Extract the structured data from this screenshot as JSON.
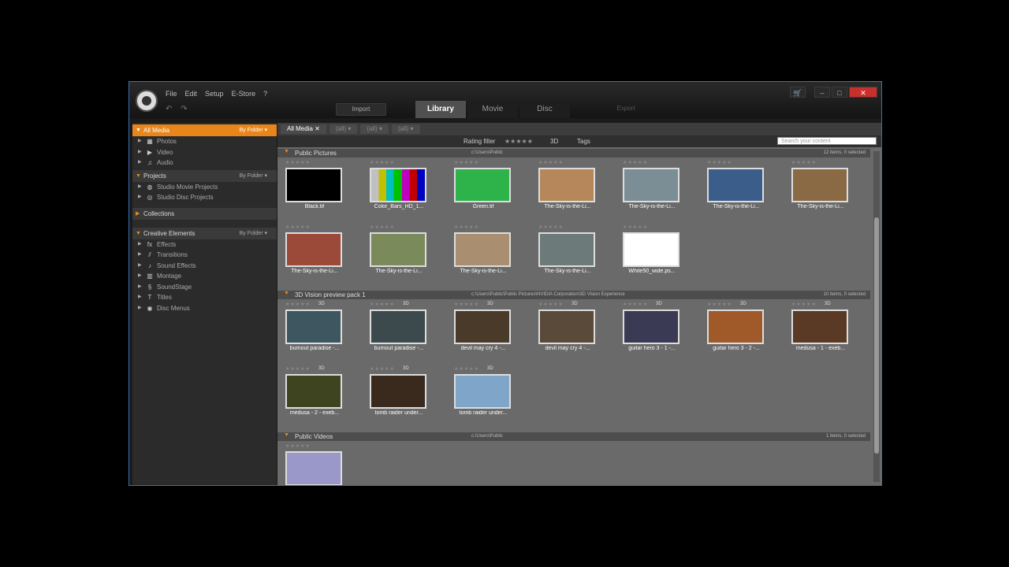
{
  "menu": [
    "File",
    "Edit",
    "Setup",
    "E-Store",
    "?"
  ],
  "toolbar": {
    "import_label": "Import",
    "export_label": "Export",
    "undo_redo": "↶ ↷"
  },
  "tabs": [
    "Library",
    "Movie",
    "Disc"
  ],
  "window_controls": {
    "cart": "🛒",
    "minimize": "–",
    "maximize": "□",
    "close": "✕"
  },
  "sidebar": {
    "all_media": {
      "label": "All Media",
      "sort": "By Folder ▾"
    },
    "media_items": [
      {
        "icon": "▦",
        "label": "Photos"
      },
      {
        "icon": "▶",
        "label": "Video"
      },
      {
        "icon": "♫",
        "label": "Audio"
      }
    ],
    "projects": {
      "label": "Projects",
      "sort": "By Folder ▾"
    },
    "project_items": [
      {
        "icon": "◍",
        "label": "Studio Movie Projects"
      },
      {
        "icon": "◎",
        "label": "Studio Disc Projects"
      }
    ],
    "collections": {
      "label": "Collections"
    },
    "creative": {
      "label": "Creative Elements",
      "sort": "By Folder ▾"
    },
    "creative_items": [
      {
        "icon": "fx",
        "label": "Effects"
      },
      {
        "icon": "⫽",
        "label": "Transitions"
      },
      {
        "icon": "♪",
        "label": "Sound Effects"
      },
      {
        "icon": "▥",
        "label": "Montage"
      },
      {
        "icon": "§",
        "label": "SoundStage"
      },
      {
        "icon": "T",
        "label": "Titles"
      },
      {
        "icon": "◉",
        "label": "Disc Menus"
      }
    ]
  },
  "filterbar": {
    "all_media": "All Media ✕",
    "filter1": "(all) ▾",
    "filter2": "(all) ▾",
    "filter3": "(all) ▾"
  },
  "ratingbar": {
    "rating_label": "Rating filter",
    "stars": "★★★★★",
    "d3": "3D",
    "tags": "Tags"
  },
  "search": {
    "placeholder": "Search your content"
  },
  "folders": [
    {
      "title": "Public Pictures",
      "path": "c:\\Users\\Public",
      "count": "12 items, 0 selected",
      "items": [
        {
          "label": "Black.tif",
          "color": "#000000",
          "d3": ""
        },
        {
          "label": "Color_Bars_HD_1...",
          "color": "#bdbdbd",
          "d3": ""
        },
        {
          "label": "Green.tif",
          "color": "#2db34a",
          "d3": ""
        },
        {
          "label": "The-Sky-is-the-Li...",
          "color": "#b5875a",
          "d3": ""
        },
        {
          "label": "The-Sky-is-the-Li...",
          "color": "#7c8e95",
          "d3": ""
        },
        {
          "label": "The-Sky-is-the-Li...",
          "color": "#3b5d8a",
          "d3": ""
        },
        {
          "label": "The-Sky-is-the-Li...",
          "color": "#8a6a45",
          "d3": ""
        },
        {
          "label": "The-Sky-is-the-Li...",
          "color": "#9b4a3a",
          "d3": ""
        },
        {
          "label": "The-Sky-is-the-Li...",
          "color": "#7a8a5a",
          "d3": ""
        },
        {
          "label": "The-Sky-is-the-Li...",
          "color": "#a98f70",
          "d3": ""
        },
        {
          "label": "The-Sky-is-the-Li...",
          "color": "#6c7a7a",
          "d3": ""
        },
        {
          "label": "White50_wide.ps...",
          "color": "#ffffff",
          "d3": ""
        }
      ]
    },
    {
      "title": "3D Vision preview pack 1",
      "path": "c:\\Users\\Public\\Public Pictures\\NVIDIA Corporation\\3D Vision Experience",
      "count": "10 items, 0 selected",
      "items": [
        {
          "label": "burnout paradise -...",
          "color": "#3e5660",
          "d3": "3D"
        },
        {
          "label": "burnout paradise -...",
          "color": "#3d4a4d",
          "d3": "3D"
        },
        {
          "label": "devil may cry 4 -...",
          "color": "#4a3a2a",
          "d3": "3D"
        },
        {
          "label": "devil may cry 4 -...",
          "color": "#5a4a3a",
          "d3": "3D"
        },
        {
          "label": "guitar hero 3 - 1 -...",
          "color": "#3a3a55",
          "d3": "3D"
        },
        {
          "label": "guitar hero 3 - 2 -...",
          "color": "#a05a2a",
          "d3": "3D"
        },
        {
          "label": "medusa - 1 - exeb...",
          "color": "#5a3a25",
          "d3": "3D"
        },
        {
          "label": "medusa - 2 - exeb...",
          "color": "#3e4420",
          "d3": "3D"
        },
        {
          "label": "tomb raider under...",
          "color": "#3a2a1e",
          "d3": "3D"
        },
        {
          "label": "tomb raider under...",
          "color": "#7fa6c8",
          "d3": "3D"
        }
      ]
    },
    {
      "title": "Public Videos",
      "path": "c:\\Users\\Public",
      "count": "1 items, 0 selected",
      "items": [
        {
          "label": "",
          "color": "#9a98c8",
          "d3": ""
        }
      ]
    }
  ],
  "item_stars": "★★★★★"
}
